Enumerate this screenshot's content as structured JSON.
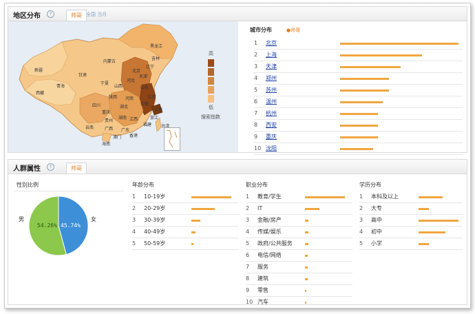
{
  "region": {
    "title": "地区分布",
    "tab_label": "帅哥",
    "subtabs": "全国  当月",
    "map": {
      "labels": [
        "新疆",
        "西藏",
        "青海",
        "甘肃",
        "内蒙古",
        "黑龙江",
        "吉林",
        "辽宁",
        "北京",
        "天津",
        "河北",
        "宁夏",
        "山西",
        "山东",
        "陕西",
        "河南",
        "江苏",
        "安徽",
        "四川",
        "重庆",
        "湖北",
        "上海",
        "浙江",
        "湖南",
        "江西",
        "贵州",
        "福建",
        "云南",
        "广西",
        "广东",
        "台湾",
        "海南",
        "香港",
        "澳门"
      ],
      "legend_high": "高",
      "legend_low": "低",
      "legend_caption": "搜索指数",
      "legend_colors": [
        "#9a4a18",
        "#b8652a",
        "#d4843c",
        "#e6a45a",
        "#f3c27c"
      ],
      "ocean_color": "#e6edf5"
    },
    "city": {
      "title": "城市分布",
      "key": "●帅哥",
      "items": [
        {
          "rank": "1",
          "name": "北京",
          "value": 1.0
        },
        {
          "rank": "2",
          "name": "上海",
          "value": 0.69
        },
        {
          "rank": "3",
          "name": "天津",
          "value": 0.51
        },
        {
          "rank": "4",
          "name": "郑州",
          "value": 0.41
        },
        {
          "rank": "5",
          "name": "苏州",
          "value": 0.41
        },
        {
          "rank": "6",
          "name": "温州",
          "value": 0.36
        },
        {
          "rank": "7",
          "name": "杭州",
          "value": 0.32
        },
        {
          "rank": "8",
          "name": "西安",
          "value": 0.32
        },
        {
          "rank": "9",
          "name": "重庆",
          "value": 0.32
        },
        {
          "rank": "10",
          "name": "沈阳",
          "value": 0.28
        }
      ]
    }
  },
  "crowd": {
    "title": "人群属性",
    "tab_label": "帅哥",
    "gender": {
      "title": "性别比例",
      "male_label": "男",
      "female_label": "女",
      "male_pct": "54.26%",
      "female_pct": "45.74%",
      "male_value": 54.26,
      "female_value": 45.74,
      "male_color": "#8cc84b",
      "female_color": "#3d8fd8"
    },
    "age": {
      "title": "年龄分布",
      "items": [
        {
          "rank": "1",
          "name": "10-19岁",
          "value": 1.0
        },
        {
          "rank": "2",
          "name": "20-29岁",
          "value": 0.58
        },
        {
          "rank": "3",
          "name": "30-39岁",
          "value": 0.22
        },
        {
          "rank": "4",
          "name": "40-49岁",
          "value": 0.1
        },
        {
          "rank": "5",
          "name": "50-59岁",
          "value": 0.05
        }
      ]
    },
    "occupation": {
      "title": "职业分布",
      "items": [
        {
          "rank": "1",
          "name": "教育/学生",
          "value": 1.0
        },
        {
          "rank": "2",
          "name": "IT",
          "value": 0.36
        },
        {
          "rank": "3",
          "name": "金融/房产",
          "value": 0.09
        },
        {
          "rank": "4",
          "name": "传媒/娱乐",
          "value": 0.09
        },
        {
          "rank": "5",
          "name": "政府/公共服务",
          "value": 0.09
        },
        {
          "rank": "6",
          "name": "电信/网络",
          "value": 0.07
        },
        {
          "rank": "7",
          "name": "服务",
          "value": 0.07
        },
        {
          "rank": "8",
          "name": "建筑",
          "value": 0.07
        },
        {
          "rank": "9",
          "name": "零售",
          "value": 0.04
        },
        {
          "rank": "10",
          "name": "汽车",
          "value": 0.04
        }
      ]
    },
    "education": {
      "title": "学历分布",
      "items": [
        {
          "rank": "1",
          "name": "本科及以上",
          "value": 0.6
        },
        {
          "rank": "2",
          "name": "大专",
          "value": 0.25
        },
        {
          "rank": "3",
          "name": "高中",
          "value": 1.0
        },
        {
          "rank": "4",
          "name": "初中",
          "value": 0.68
        },
        {
          "rank": "5",
          "name": "小学",
          "value": 0.25
        }
      ]
    }
  }
}
